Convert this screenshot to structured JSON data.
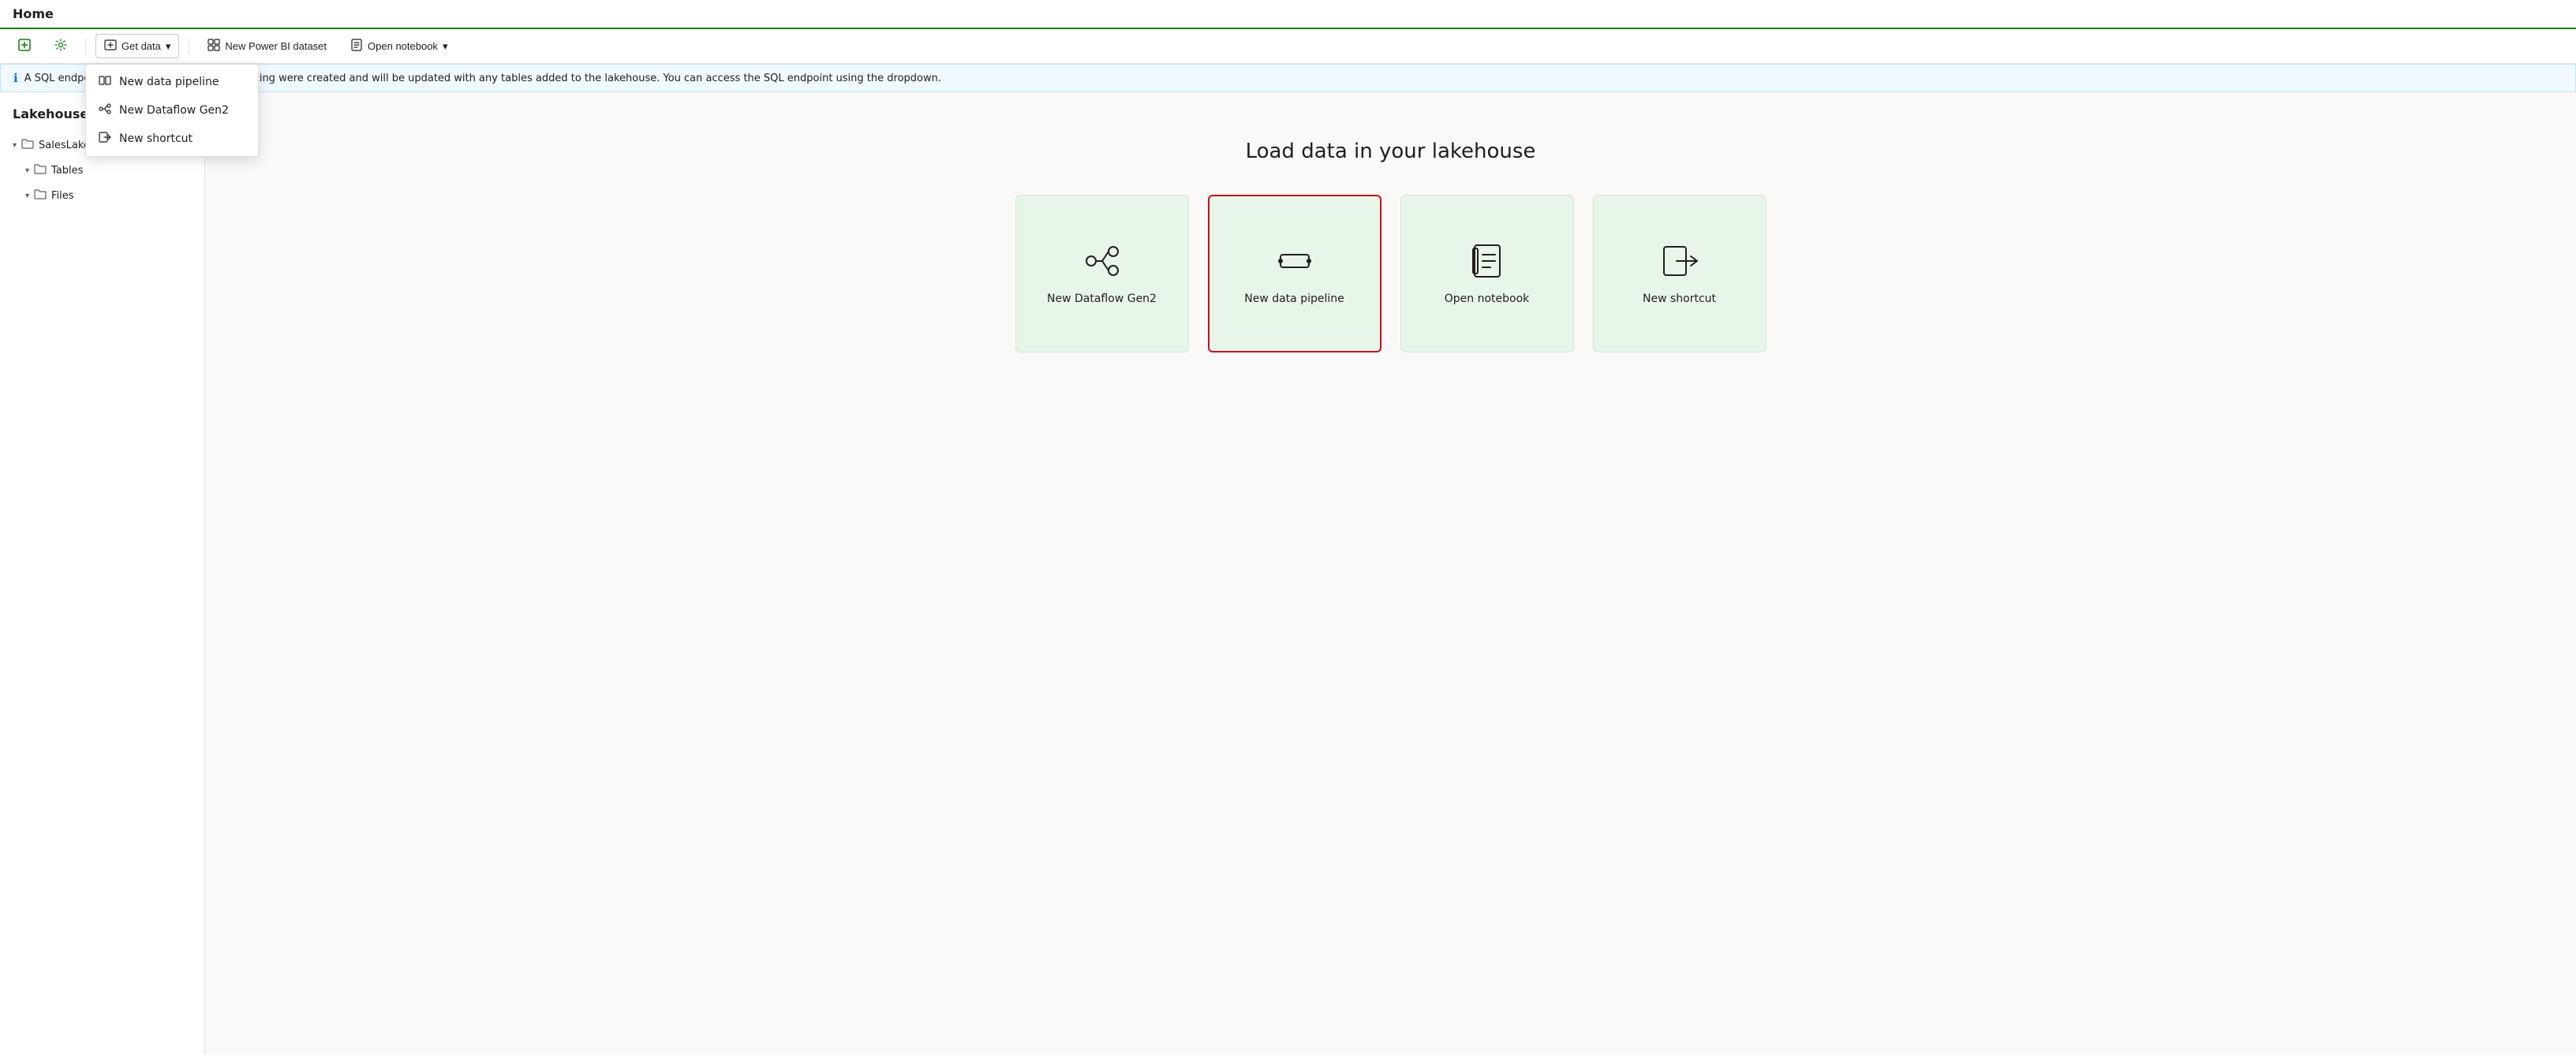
{
  "page": {
    "title": "Home"
  },
  "toolbar": {
    "new_btn_label": "",
    "settings_btn_label": "",
    "get_data_label": "Get data",
    "new_powerbi_label": "New Power BI dataset",
    "open_notebook_label": "Open notebook"
  },
  "dropdown": {
    "items": [
      {
        "id": "new-data-pipeline",
        "label": "New data pipeline"
      },
      {
        "id": "new-dataflow-gen2",
        "label": "New Dataflow Gen2"
      },
      {
        "id": "new-shortcut",
        "label": "New shortcut"
      }
    ]
  },
  "info_bar": {
    "text": "A SQL endpoint and default dataset for reporting were created and will be updated with any tables added to the lakehouse. You can access the SQL endpoint using the dropdown."
  },
  "sidebar": {
    "title": "Lakehouse",
    "tree": {
      "root": "SalesLakehouse",
      "children": [
        {
          "label": "Tables"
        },
        {
          "label": "Files"
        }
      ]
    }
  },
  "content": {
    "heading": "Load data in your lakehouse",
    "cards": [
      {
        "id": "new-dataflow-gen2",
        "label": "New Dataflow Gen2",
        "icon": "dataflow"
      },
      {
        "id": "new-data-pipeline",
        "label": "New data pipeline",
        "icon": "pipeline",
        "highlighted": true
      },
      {
        "id": "open-notebook",
        "label": "Open notebook",
        "icon": "notebook"
      },
      {
        "id": "new-shortcut",
        "label": "New shortcut",
        "icon": "shortcut"
      }
    ]
  }
}
